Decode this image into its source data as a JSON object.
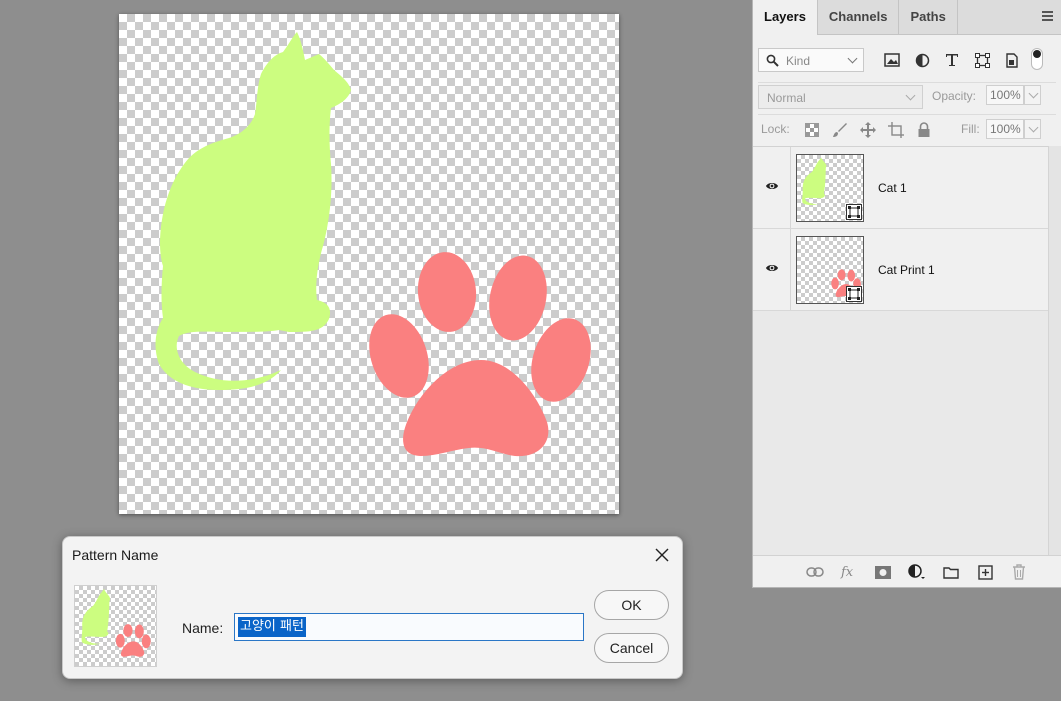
{
  "layers_panel": {
    "tabs": [
      {
        "label": "Layers",
        "active": true
      },
      {
        "label": "Channels",
        "active": false
      },
      {
        "label": "Paths",
        "active": false
      }
    ],
    "filter": {
      "kind_placeholder": "Kind",
      "icons": [
        "image-filter-icon",
        "adjustment-filter-icon",
        "type-filter-icon",
        "shape-filter-icon",
        "smart-object-filter-icon"
      ]
    },
    "blend_mode": "Normal",
    "opacity_label": "Opacity:",
    "opacity_value": "100%",
    "lock_label": "Lock:",
    "fill_label": "Fill:",
    "fill_value": "100%",
    "layers": [
      {
        "name": "Cat 1",
        "visible": true,
        "smart_object": true
      },
      {
        "name": "Cat Print 1",
        "visible": true,
        "smart_object": true
      }
    ],
    "footer_icons": [
      "link-icon",
      "fx-icon",
      "mask-icon",
      "adjustment-icon",
      "folder-icon",
      "new-layer-icon",
      "trash-icon"
    ]
  },
  "canvas": {
    "background": "transparent",
    "cat_color": "#ccfd80",
    "paw_color": "#fa8080"
  },
  "dialog": {
    "title": "Pattern Name",
    "name_label": "Name:",
    "name_value": "고양이 패턴",
    "ok_label": "OK",
    "cancel_label": "Cancel"
  }
}
